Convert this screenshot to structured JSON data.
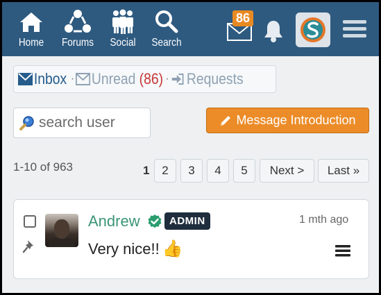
{
  "nav": {
    "home_label": "Home",
    "forums_label": "Forums",
    "social_label": "Social",
    "search_label": "Search",
    "mail_count": "86"
  },
  "tabs": {
    "inbox_label": "Inbox",
    "unread_label": "Unread",
    "unread_count": "(86)",
    "requests_label": "Requests",
    "separator": "·"
  },
  "search": {
    "placeholder": "search user"
  },
  "intro_button": {
    "label": "Message Introduction"
  },
  "pagination": {
    "range_text": "1-10 of 963",
    "current_page": "1",
    "pages": [
      "2",
      "3",
      "4",
      "5"
    ],
    "next_label": "Next >",
    "last_label": "Last »"
  },
  "message": {
    "sender": "Andrew",
    "role_badge": "ADMIN",
    "time": "1 mth ago",
    "text": "Very nice!!",
    "emoji": "👍",
    "pinned": true,
    "verified": true
  },
  "colors": {
    "header_bg": "#2e5a80",
    "accent_orange": "#ec8c28",
    "sender_green": "#3a9575",
    "unread_red": "#c93636"
  }
}
